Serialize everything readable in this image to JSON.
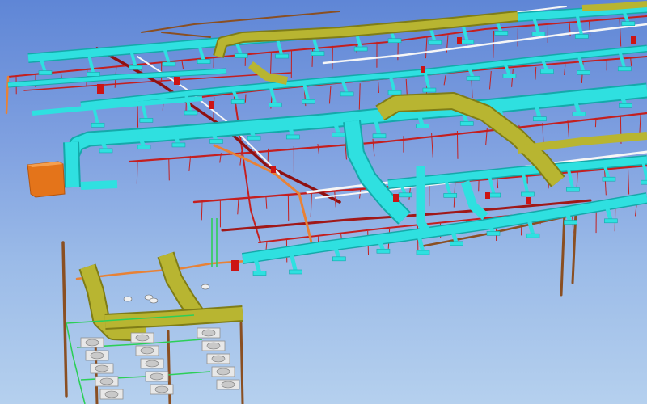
{
  "viewport": {
    "background_top": "#5f86d6",
    "background_bottom": "#b5d0ee"
  },
  "systems": {
    "supply_duct": "#2fe0e0",
    "supply_duct_dark": "#14a9aa",
    "return_duct": "#b8b531",
    "return_duct_dark": "#7f7d17",
    "sprinkler_pipe": "#c41f1f",
    "drain_pipe": "#9b5a2a",
    "hot_water_pipe": "#e88236",
    "domestic_water": "#f2f2f2",
    "equipment_block": "#f2801f",
    "fixture": "#d9d9d9",
    "green_pipe": "#2ccf58"
  }
}
